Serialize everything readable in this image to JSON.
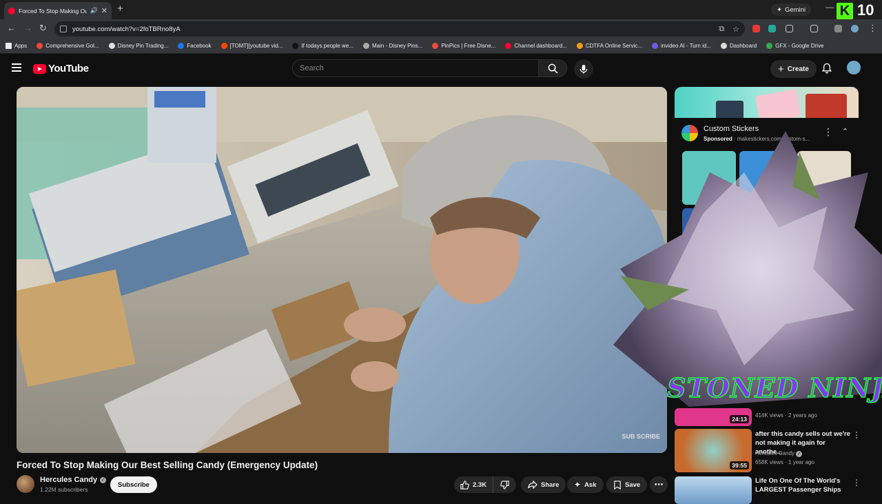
{
  "browser": {
    "tab_title": "Forced To Stop Making Ou",
    "url": "youtube.com/watch?v=2foTBRno8yA",
    "gemini_label": "Gemini",
    "kick_count": "10"
  },
  "bookmarks": [
    {
      "label": "Apps",
      "color": "#e8eaed"
    },
    {
      "label": "Comprehensive Gol...",
      "color": "#e74c3c"
    },
    {
      "label": "Disney Pin Trading...",
      "color": "#ddd"
    },
    {
      "label": "Facebook",
      "color": "#1877f2"
    },
    {
      "label": "[TOMT][youtube vid...",
      "color": "#ff4500"
    },
    {
      "label": "If todays people we...",
      "color": "#111"
    },
    {
      "label": "Main - Disney Pins...",
      "color": "#aaa"
    },
    {
      "label": "PinPics | Free Disne...",
      "color": "#e74c3c"
    },
    {
      "label": "Channel dashboard...",
      "color": "#ff0033"
    },
    {
      "label": "CDTFA Online Servic...",
      "color": "#f39c12"
    },
    {
      "label": "invideo AI - Turn id...",
      "color": "#6c5ce7"
    },
    {
      "label": "Dashboard",
      "color": "#ddd"
    },
    {
      "label": "GFX - Google Drive",
      "color": "#34a853"
    }
  ],
  "youtube": {
    "logo_text": "YouTube",
    "search_placeholder": "Search",
    "create_label": "Create"
  },
  "player": {
    "watermark": "SUB SCRIBE"
  },
  "ad": {
    "title": "Custom Stickers",
    "sponsored": "Sponsored",
    "domain": "makestickers.com/custom-s..."
  },
  "overlay": {
    "text": "STONED NINJA"
  },
  "recommendations": [
    {
      "title": "",
      "channel": "",
      "views": "414K views · 2 years ago",
      "duration": "24:13",
      "thumb_color": "#e0368a"
    },
    {
      "title": "after this candy sells out we're not making it again for anothe...",
      "channel": "Hercules Candy",
      "views": "658K views · 1 year ago",
      "duration": "39:55",
      "thumb_color": "#c86a2e"
    },
    {
      "title": "Life On One Of The World's LARGEST Passenger Ships",
      "channel": "",
      "views": "",
      "duration": "",
      "thumb_color": "#7fb0d8"
    }
  ],
  "video": {
    "title": "Forced To Stop Making Our Best Selling Candy (Emergency Update)",
    "channel": "Hercules Candy",
    "subscribers": "1.22M subscribers",
    "subscribe_label": "Subscribe",
    "likes": "2.3K",
    "share_label": "Share",
    "ask_label": "Ask",
    "save_label": "Save"
  }
}
